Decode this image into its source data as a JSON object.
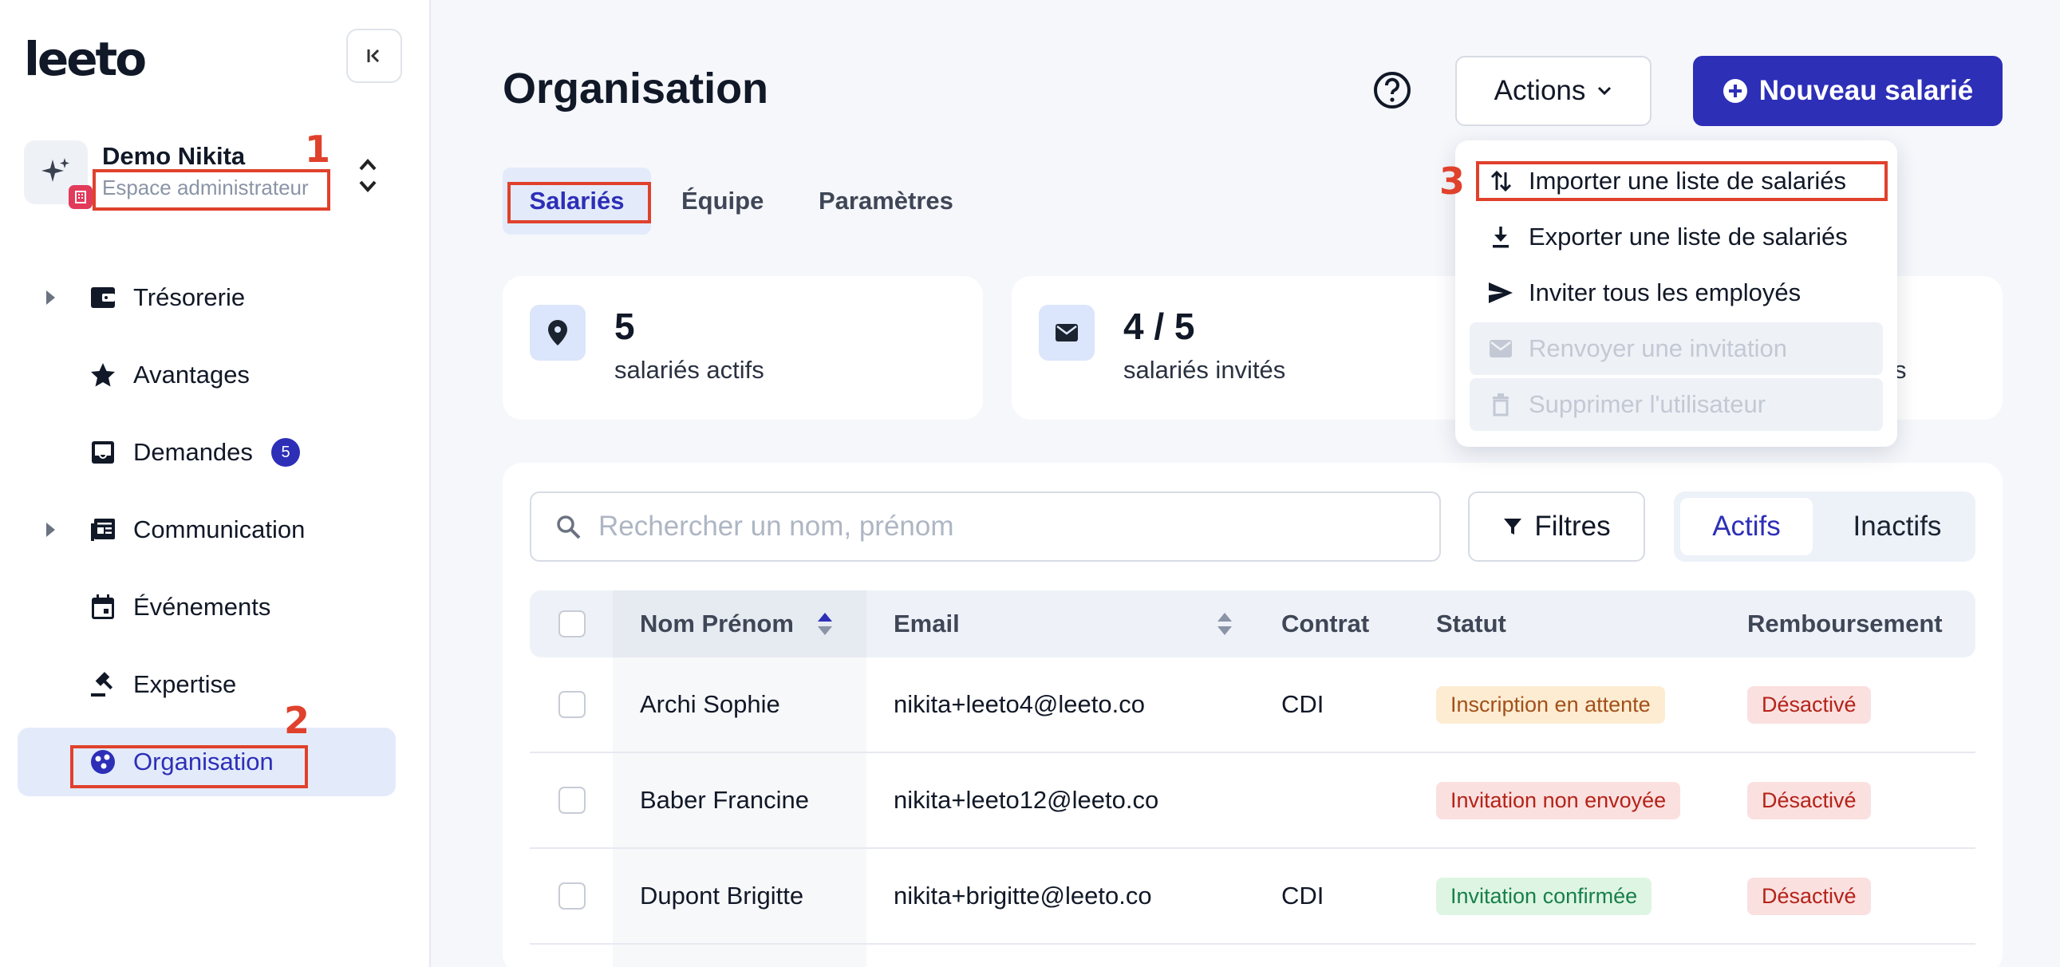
{
  "app": {
    "logo": "leeto"
  },
  "workspace": {
    "name": "Demo Nikita",
    "role": "Espace administrateur"
  },
  "annotations": {
    "one": "1",
    "two": "2",
    "three": "3"
  },
  "sidebar": {
    "items": [
      {
        "label": "Trésorerie",
        "icon": "wallet-icon",
        "expandable": true
      },
      {
        "label": "Avantages",
        "icon": "star-icon",
        "expandable": false
      },
      {
        "label": "Demandes",
        "icon": "inbox-icon",
        "expandable": false,
        "count": "5"
      },
      {
        "label": "Communication",
        "icon": "newspaper-icon",
        "expandable": true
      },
      {
        "label": "Événements",
        "icon": "calendar-icon",
        "expandable": false
      },
      {
        "label": "Expertise",
        "icon": "gavel-icon",
        "expandable": false
      },
      {
        "label": "Organisation",
        "icon": "organisation-icon",
        "expandable": false,
        "active": true
      }
    ]
  },
  "header": {
    "title": "Organisation",
    "actions_label": "Actions",
    "primary_label": "Nouveau salarié"
  },
  "tabs": [
    {
      "label": "Salariés",
      "active": true
    },
    {
      "label": "Équipe"
    },
    {
      "label": "Paramètres"
    }
  ],
  "stats": [
    {
      "value": "5",
      "label": "salariés actifs",
      "icon": "location-pin-icon"
    },
    {
      "value": "4 / 5",
      "label": "salariés invités",
      "icon": "mail-icon"
    },
    {
      "value": "",
      "label": "s"
    }
  ],
  "search": {
    "placeholder": "Rechercher un nom, prénom",
    "value": ""
  },
  "filters_label": "Filtres",
  "segment": {
    "active": "Actifs",
    "inactive": "Inactifs"
  },
  "table": {
    "columns": [
      "Nom Prénom",
      "Email",
      "Contrat",
      "Statut",
      "Remboursement"
    ],
    "rows": [
      {
        "name": "Archi Sophie",
        "email": "nikita+leeto4@leeto.co",
        "contract": "CDI",
        "status": "Inscription en attente",
        "status_tone": "orange",
        "refund": "Désactivé"
      },
      {
        "name": "Baber Francine",
        "email": "nikita+leeto12@leeto.co",
        "contract": "",
        "status": "Invitation non envoyée",
        "status_tone": "red",
        "refund": "Désactivé"
      },
      {
        "name": "Dupont Brigitte",
        "email": "nikita+brigitte@leeto.co",
        "contract": "CDI",
        "status": "Invitation confirmée",
        "status_tone": "green",
        "refund": "Désactivé"
      }
    ]
  },
  "dropdown": {
    "items": [
      {
        "label": "Importer une liste de salariés",
        "icon": "import-arrows-icon",
        "disabled": false
      },
      {
        "label": "Exporter une liste de salariés",
        "icon": "download-icon",
        "disabled": false
      },
      {
        "label": "Inviter tous les employés",
        "icon": "send-icon",
        "disabled": false
      },
      {
        "label": "Renvoyer une invitation",
        "icon": "mail-icon",
        "disabled": true
      },
      {
        "label": "Supprimer l'utilisateur",
        "icon": "trash-icon",
        "disabled": true
      }
    ]
  },
  "colors": {
    "brand": "#2d2fb7",
    "annotation": "#e0412c",
    "active_bg": "#e3ebfb"
  }
}
